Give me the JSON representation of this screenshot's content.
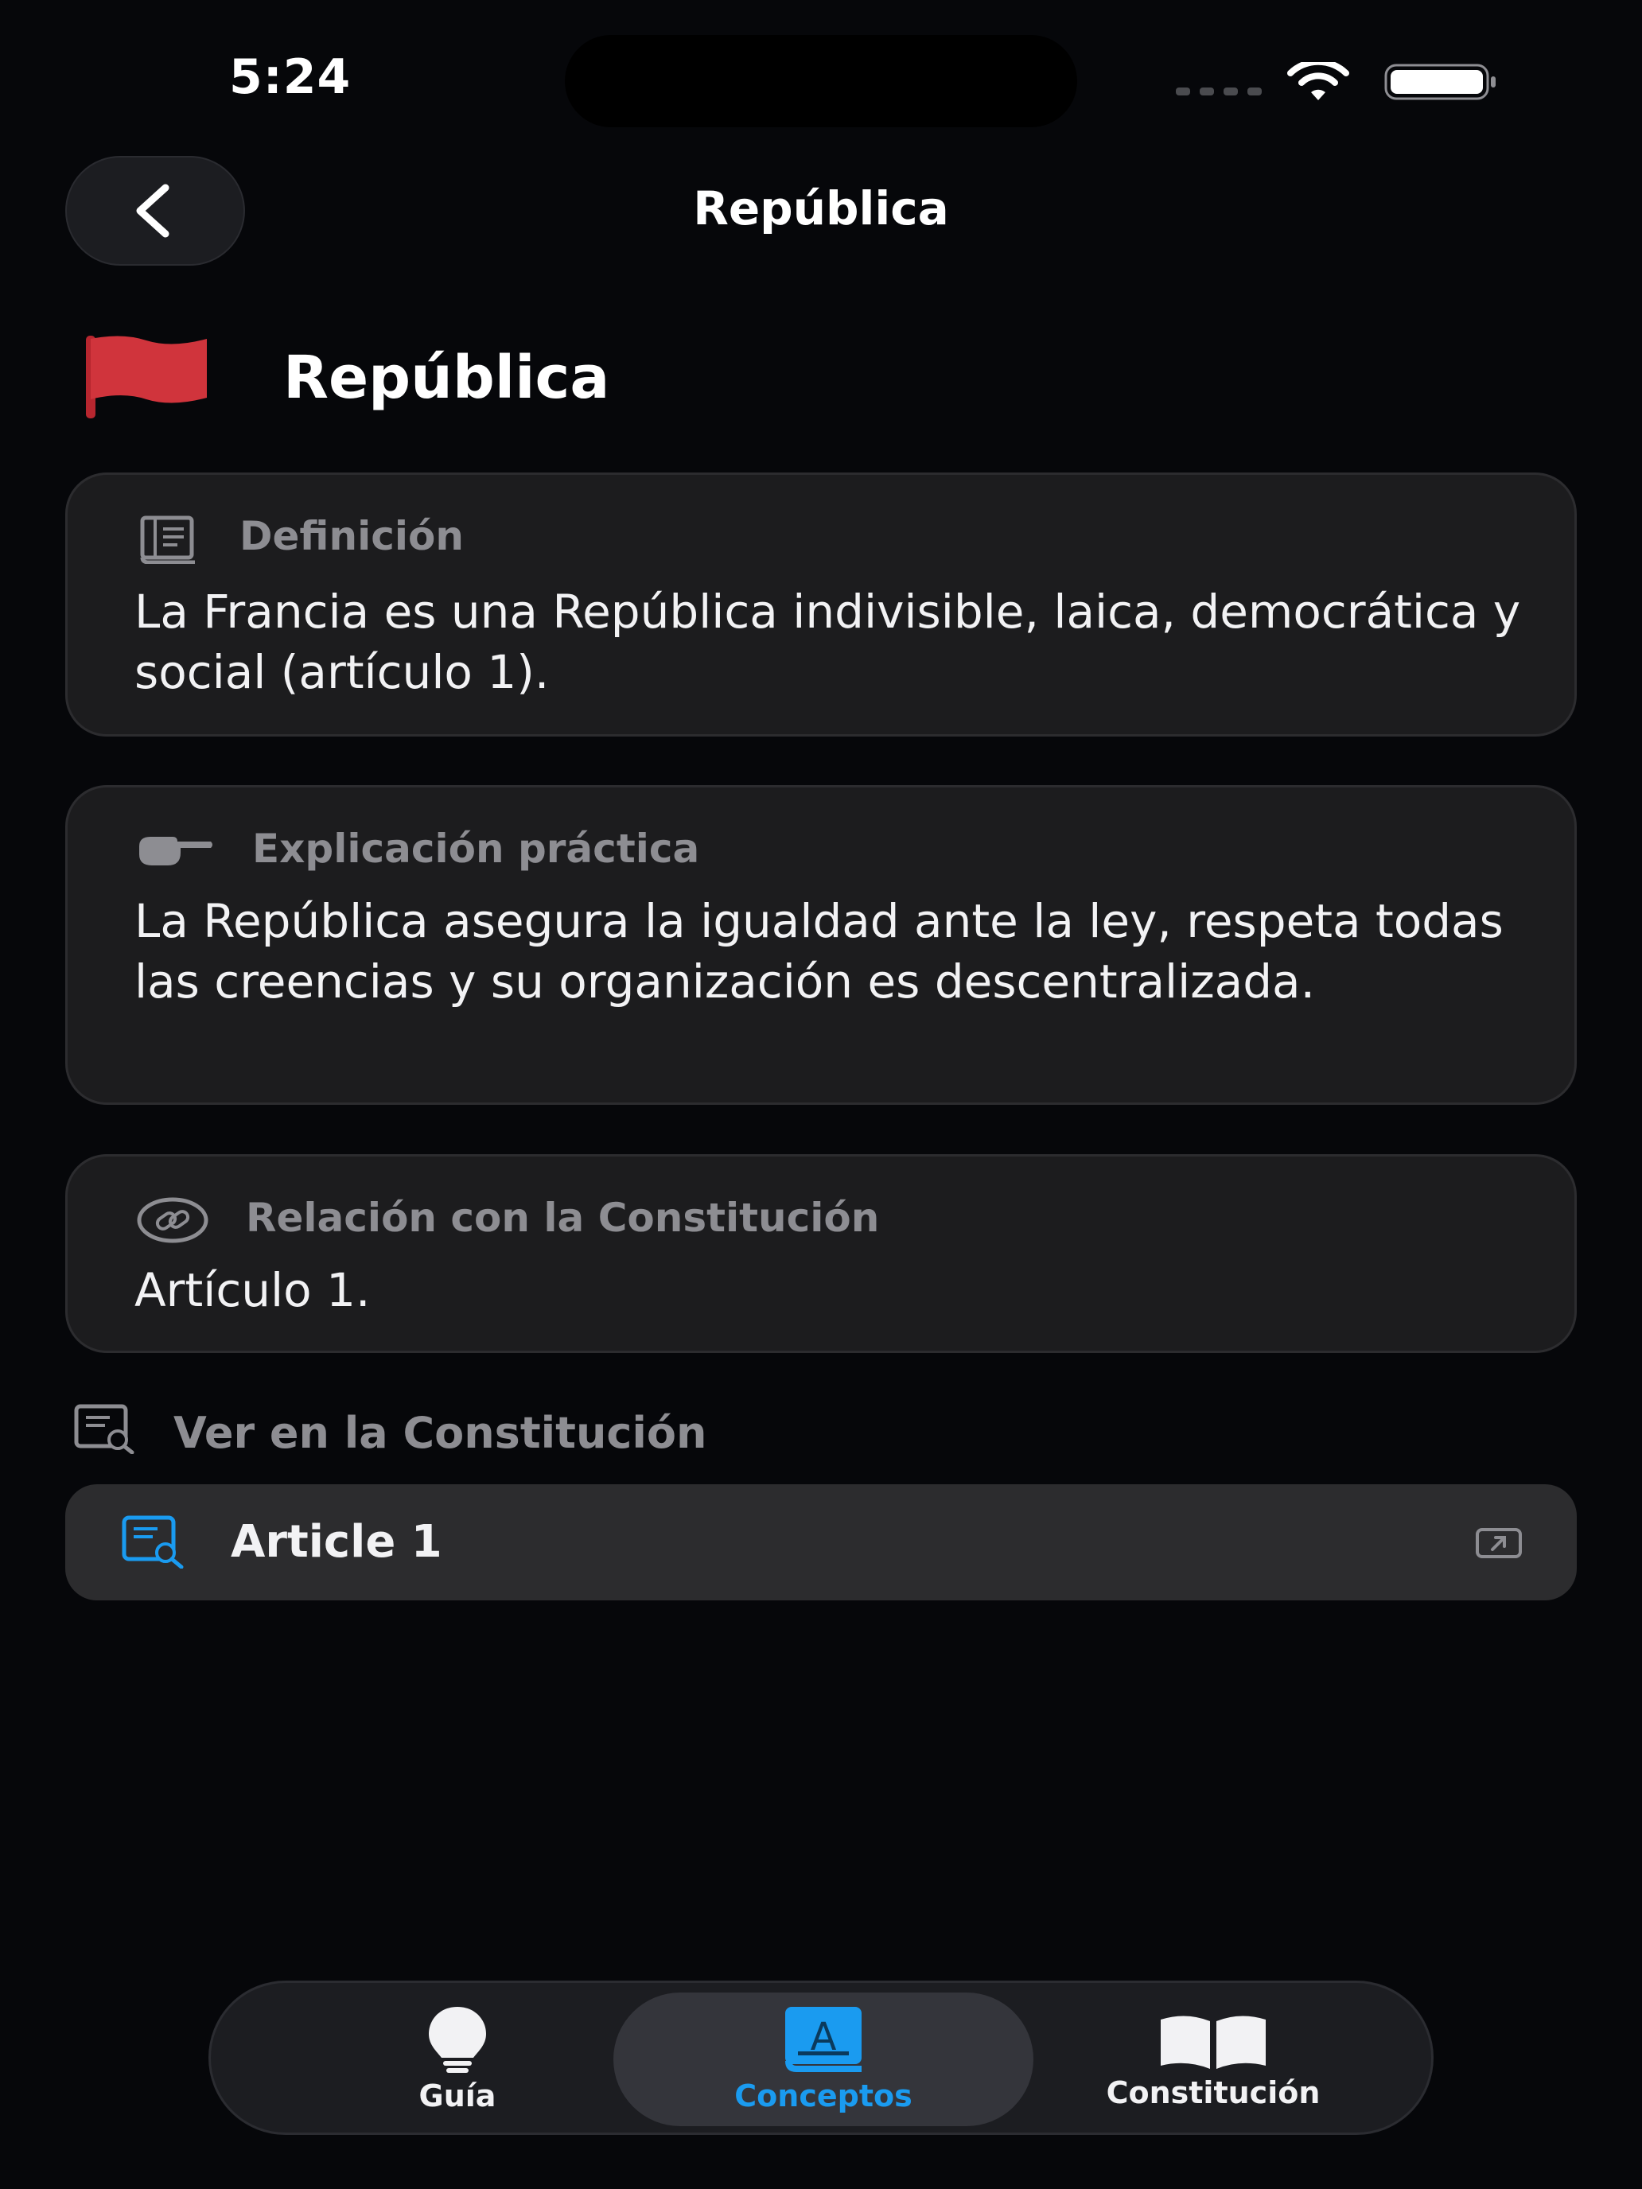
{
  "status_bar": {
    "time": "5:24"
  },
  "header": {
    "title": "República",
    "back_icon": "chevron-left-icon"
  },
  "concept": {
    "title": "República",
    "flag_color": "#d0343c"
  },
  "cards": {
    "definition": {
      "label": "Definición",
      "icon": "book-icon",
      "text": "La Francia es una República indivisible, laica, democrática y social (artículo 1)."
    },
    "practical": {
      "label": "Explicación práctica",
      "icon": "pointing-hand-icon",
      "text": "La República asegura la igualdad ante la ley, respeta todas las creencias y su organización es descentralizada."
    },
    "relation": {
      "label": "Relación con la Constitución",
      "icon": "link-icon",
      "text": "Artículo 1."
    }
  },
  "see_in_constitution": {
    "label": "Ver en la Constitución",
    "icon": "document-search-icon",
    "items": [
      {
        "label": "Article 1",
        "icon": "document-search-icon",
        "action_icon": "open-external-icon"
      }
    ]
  },
  "tabbar": {
    "tabs": [
      {
        "label": "Guía",
        "icon": "lightbulb-icon",
        "active": false
      },
      {
        "label": "Conceptos",
        "icon": "glossary-book-icon",
        "active": true
      },
      {
        "label": "Constitución",
        "icon": "open-book-icon",
        "active": false
      }
    ],
    "active_color": "#1a9bf0",
    "inactive_color": "#f2f2f4"
  }
}
